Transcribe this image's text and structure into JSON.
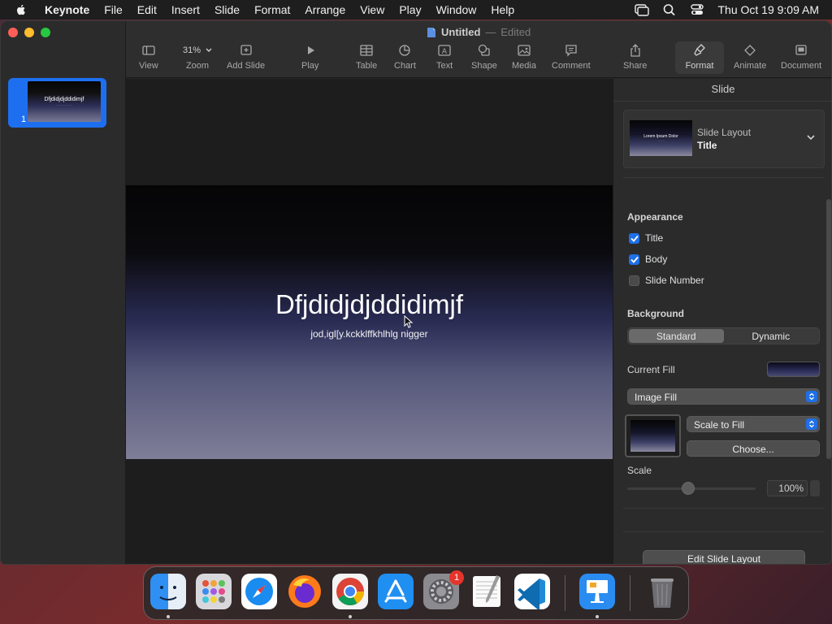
{
  "menubar": {
    "app_name": "Keynote",
    "items": [
      "File",
      "Edit",
      "Insert",
      "Slide",
      "Format",
      "Arrange",
      "View",
      "Play",
      "Window",
      "Help"
    ],
    "clock": "Thu Oct 19  9:09 AM"
  },
  "window": {
    "doc_name": "Untitled",
    "doc_separator": "—",
    "doc_status": "Edited"
  },
  "toolbar": {
    "view": "View",
    "zoom_value": "31%",
    "zoom": "Zoom",
    "add_slide": "Add Slide",
    "play": "Play",
    "table": "Table",
    "chart": "Chart",
    "text": "Text",
    "shape": "Shape",
    "media": "Media",
    "comment": "Comment",
    "share": "Share",
    "format": "Format",
    "animate": "Animate",
    "document": "Document"
  },
  "navigator": {
    "slides": [
      {
        "number": "1",
        "title": "Dfjdidjdjddidimjf"
      }
    ]
  },
  "slide": {
    "title": "Dfjdidjdjddidimjf",
    "body": "jod,igl[y.kckklffkhlhlg nigger"
  },
  "inspector": {
    "header": "Slide",
    "layout_label": "Slide Layout",
    "layout_value": "Title",
    "layout_thumb_title": "Lorem Ipsum Dolor",
    "appearance_title": "Appearance",
    "appearance": [
      {
        "label": "Title",
        "checked": true
      },
      {
        "label": "Body",
        "checked": true
      },
      {
        "label": "Slide Number",
        "checked": false
      }
    ],
    "background_title": "Background",
    "bg_standard": "Standard",
    "bg_dynamic": "Dynamic",
    "current_fill": "Current Fill",
    "fill_type": "Image Fill",
    "scale_mode": "Scale to Fill",
    "choose": "Choose...",
    "scale_label": "Scale",
    "scale_value": "100%",
    "edit_layout": "Edit Slide Layout"
  },
  "dock": {
    "apps": [
      "Finder",
      "Launchpad",
      "Safari",
      "Firefox",
      "Chrome",
      "App Store",
      "System Settings",
      "TextEdit",
      "Visual Studio Code",
      "Keynote",
      "Trash"
    ],
    "settings_badge": "1"
  },
  "colors": {
    "accent": "#1f6ff0",
    "menubar_bg": "#1e1e1e",
    "window_bg": "#262626"
  }
}
